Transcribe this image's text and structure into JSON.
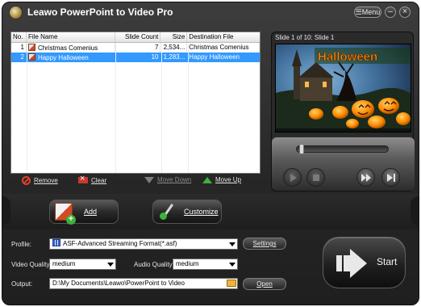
{
  "window": {
    "title": "Leawo PowerPoint to Video Pro",
    "menu_label": "Menu",
    "minimize": "–",
    "close": "×"
  },
  "file_list": {
    "columns": [
      "No.",
      "File Name",
      "Slide Count",
      "Size",
      "Destination File"
    ],
    "rows": [
      {
        "no": "1",
        "name": "Christmas Comenius",
        "slide_count": "7",
        "size": "2,534...",
        "destination": "Christmas Comenius",
        "selected": false
      },
      {
        "no": "2",
        "name": "Happy Halloween",
        "slide_count": "10",
        "size": "1,283...",
        "destination": "Happy Halloween",
        "selected": true
      }
    ]
  },
  "list_toolbar": {
    "remove": "Remove",
    "clear": "Clear",
    "move_down": "Move Down",
    "move_up": "Move Up"
  },
  "preview": {
    "label": "Slide 1 of 10: Slide 1",
    "slide_heading": "Halloween",
    "seek_fraction": 0.02
  },
  "actions": {
    "add": "Add",
    "customize": "Customize"
  },
  "form": {
    "profile_label": "Profile:",
    "profile_value": "ASF-Advanced Streaming Format(*.asf)",
    "settings_label": "Settings",
    "video_quality_label": "Video Quality:",
    "video_quality_value": "medium",
    "audio_quality_label": "Audio Quality:",
    "audio_quality_value": "medium",
    "output_label": "Output:",
    "output_value": "D:\\My Documents\\Leawo\\PowerPoint to Video",
    "open_label": "Open"
  },
  "start": {
    "label": "Start"
  },
  "colors": {
    "selection": "#3399ff",
    "window_bg": "#2a2a2a",
    "halloween_orange": "#ff8a00"
  }
}
